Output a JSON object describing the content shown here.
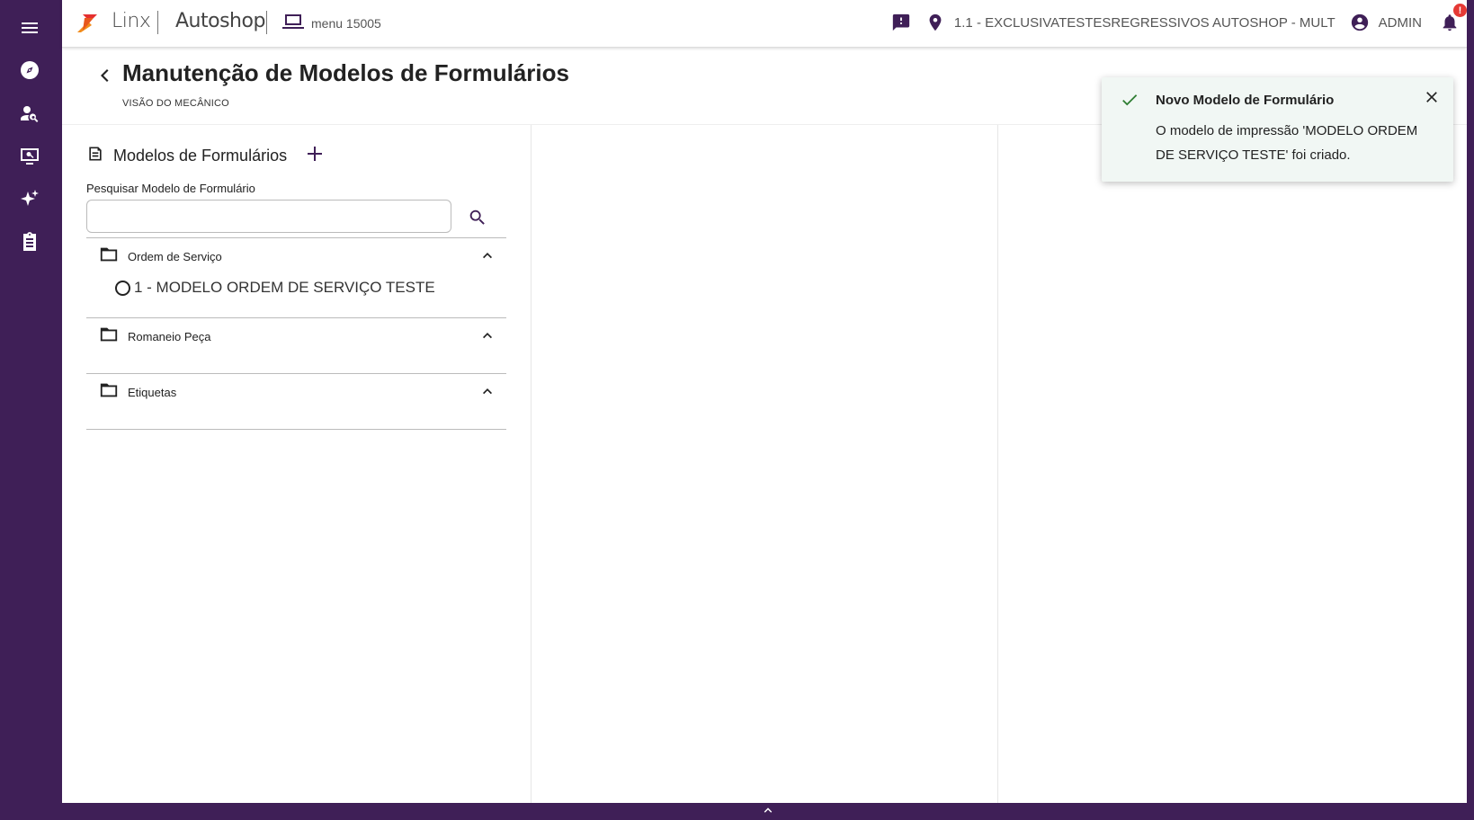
{
  "sidebar": {
    "icons": [
      "menu-icon",
      "compass-icon",
      "person-search-icon",
      "monitor-search-icon",
      "sparkles-icon",
      "clipboard-icon"
    ]
  },
  "topbar": {
    "brand": "Linx",
    "product": "Autoshop",
    "menu_label": "menu 15005",
    "location": "1.1 - EXCLUSIVATESTESREGRESSIVOS AUTOSHOP - MULT",
    "user": "ADMIN",
    "notification_count": "!"
  },
  "page": {
    "title": "Manutenção de Modelos de Formulários",
    "subtitle": "VISÃO DO MECÂNICO"
  },
  "panel": {
    "title": "Modelos de Formulários",
    "search_label": "Pesquisar Modelo de Formulário",
    "search_value": "",
    "groups": [
      {
        "label": "Ordem de Serviço",
        "items": [
          {
            "label": "1 - MODELO ORDEM DE SERVIÇO TESTE"
          }
        ]
      },
      {
        "label": "Romaneio Peça",
        "items": []
      },
      {
        "label": "Etiquetas",
        "items": []
      }
    ]
  },
  "toast": {
    "title": "Novo Modelo de Formulário",
    "message": "O modelo de impressão 'MODELO ORDEM DE SERVIÇO TESTE' foi criado."
  },
  "colors": {
    "brand_purple": "#3f1f57",
    "success_green": "#2e7d32",
    "badge_red": "#e53935"
  }
}
